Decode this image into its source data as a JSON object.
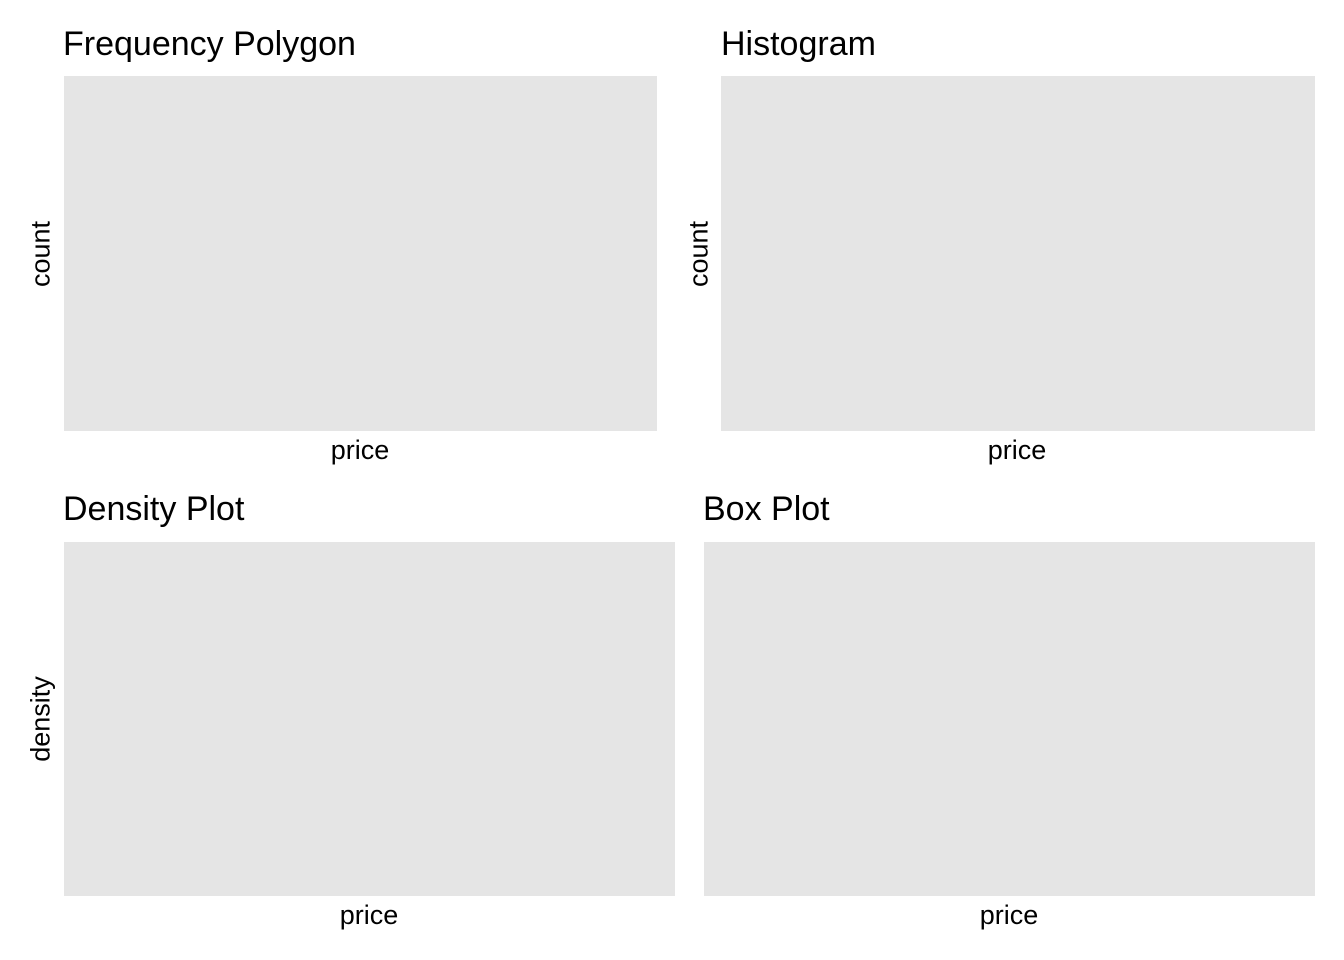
{
  "colors": {
    "panel_background": "#E5E5E5",
    "page_background": "#FFFFFF",
    "text": "#000000"
  },
  "chart_data": [
    {
      "type": "line",
      "title": "Frequency Polygon",
      "xlabel": "price",
      "ylabel": "count",
      "series": [],
      "grid": false
    },
    {
      "type": "bar",
      "title": "Histogram",
      "xlabel": "price",
      "ylabel": "count",
      "series": [],
      "grid": false
    },
    {
      "type": "area",
      "title": "Density Plot",
      "xlabel": "price",
      "ylabel": "density",
      "series": [],
      "grid": false
    },
    {
      "type": "bar",
      "title": "Box Plot",
      "xlabel": "price",
      "ylabel": "",
      "series": [],
      "grid": false
    }
  ]
}
